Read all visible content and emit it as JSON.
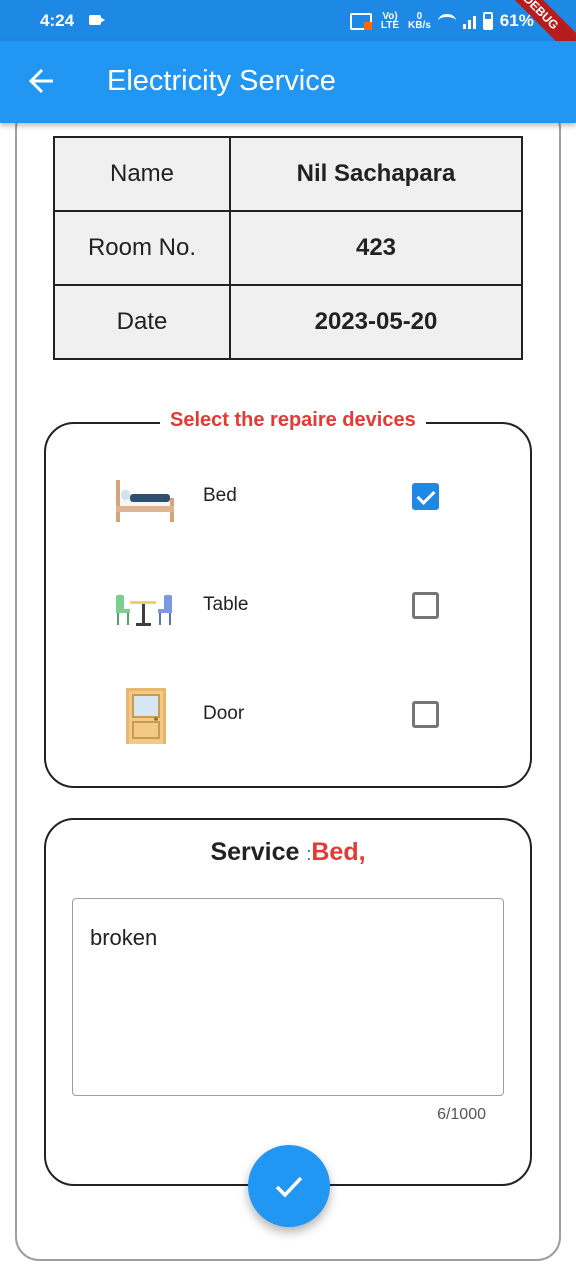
{
  "status_bar": {
    "time": "4:24",
    "volte": "Vo) LTE",
    "speed_value": "0",
    "speed_unit": "KB/s",
    "battery": "61%"
  },
  "debug_banner": "DEBUG",
  "app_bar": {
    "title": "Electricity Service",
    "back_icon": "arrow-left-icon"
  },
  "info_table": [
    {
      "label": "Name",
      "value": "Nil Sachapara"
    },
    {
      "label": "Room No.",
      "value": "423"
    },
    {
      "label": "Date",
      "value": "2023-05-20"
    }
  ],
  "devices": {
    "legend": "Select the repaire devices",
    "items": [
      {
        "label": "Bed",
        "icon": "bed-icon",
        "checked": true
      },
      {
        "label": "Table",
        "icon": "table-chairs-icon",
        "checked": false
      },
      {
        "label": "Door",
        "icon": "door-icon",
        "checked": false
      }
    ]
  },
  "service": {
    "label": "Service",
    "separator": ":",
    "value": "Bed,",
    "text": "broken",
    "char_count": "6/1000"
  },
  "fab": {
    "icon": "check-icon"
  },
  "colors": {
    "primary": "#2196f3",
    "status_bar": "#1e88e5",
    "accent_red": "#e53935",
    "checkbox_checked": "#1e88e5"
  }
}
